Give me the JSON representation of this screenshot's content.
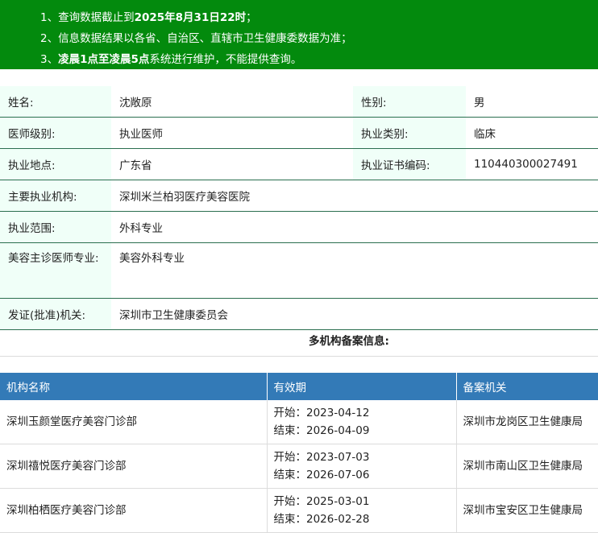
{
  "notice": {
    "line1_prefix": "1、查询数据截止到",
    "line1_bold": "2025年8月31日22时",
    "line1_suffix": "；",
    "line2": "2、信息数据结果以各省、自治区、直辖市卫生健康委数据为准；",
    "line3_prefix": "3、",
    "line3_bold": "凌晨1点至凌晨5点",
    "line3_suffix": "系统进行维护，不能提供查询。"
  },
  "info": {
    "name_label": "姓名:",
    "name": "沈敞原",
    "gender_label": "性别:",
    "gender": "男",
    "level_label": "医师级别:",
    "level": "执业医师",
    "category_label": "执业类别:",
    "category": "临床",
    "location_label": "执业地点:",
    "location": "广东省",
    "cert_label": "执业证书编码:",
    "cert": "110440300027491",
    "org_label": "主要执业机构:",
    "org": "深圳米兰柏羽医疗美容医院",
    "scope_label": "执业范围:",
    "scope": "外科专业",
    "cosmetic_label": "美容主诊医师专业:",
    "cosmetic": "美容外科专业",
    "issuer_label": "发证(批准)机关:",
    "issuer": "深圳市卫生健康委员会"
  },
  "multi_title": "多机构备案信息:",
  "registrations": {
    "headers": [
      "机构名称",
      "有效期",
      "备案机关"
    ],
    "rows": [
      {
        "org": "深圳玉颜堂医疗美容门诊部",
        "start": "开始：2023-04-12",
        "end": "结束：2026-04-09",
        "authority": "深圳市龙岗区卫生健康局"
      },
      {
        "org": "深圳禧悦医疗美容门诊部",
        "start": "开始：2023-07-03",
        "end": "结束：2026-07-06",
        "authority": "深圳市南山区卫生健康局"
      },
      {
        "org": "深圳柏栖医疗美容门诊部",
        "start": "开始：2025-03-01",
        "end": "结束：2026-02-28",
        "authority": "深圳市宝安区卫生健康局"
      }
    ]
  }
}
